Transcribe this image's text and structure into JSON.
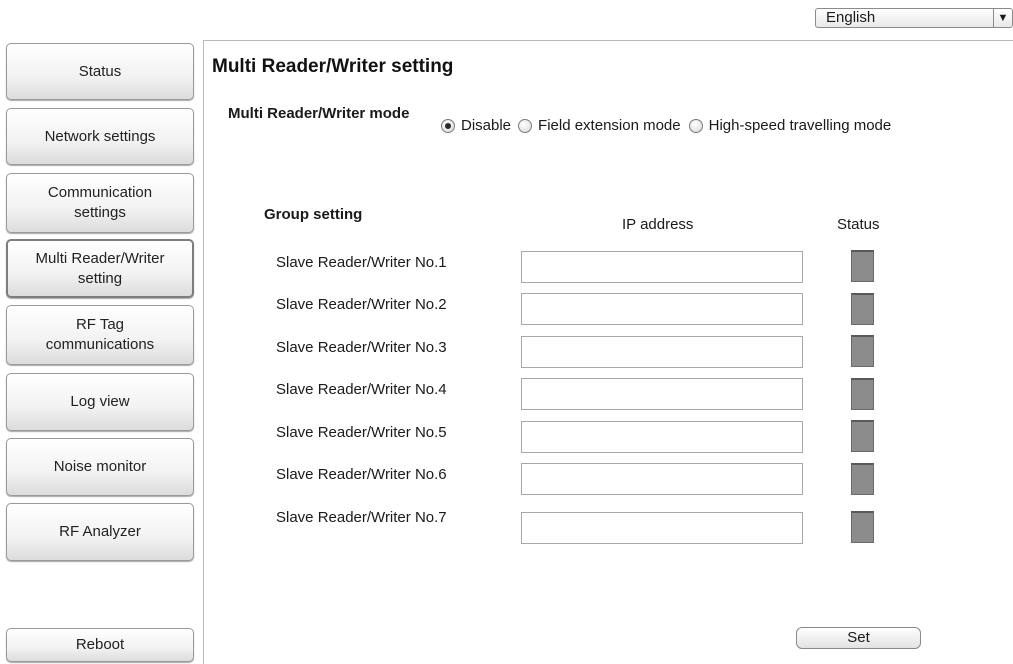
{
  "language": {
    "selected": "English"
  },
  "sidebar": {
    "items": [
      {
        "label": "Status"
      },
      {
        "label": "Network settings"
      },
      {
        "label": "Communication settings"
      },
      {
        "label": "Multi Reader/Writer setting"
      },
      {
        "label": "RF Tag communications"
      },
      {
        "label": "Log view"
      },
      {
        "label": "Noise monitor"
      },
      {
        "label": "RF Analyzer"
      }
    ],
    "reboot_label": "Reboot"
  },
  "main": {
    "title": "Multi Reader/Writer setting",
    "mode": {
      "label": "Multi Reader/Writer mode",
      "options": [
        {
          "label": "Disable",
          "checked": true
        },
        {
          "label": "Field extension mode",
          "checked": false
        },
        {
          "label": "High-speed travelling mode",
          "checked": false
        }
      ]
    },
    "group": {
      "label": "Group setting",
      "col_ip": "IP address",
      "col_status": "Status",
      "rows": [
        {
          "label": "Slave Reader/Writer No.1",
          "ip": ""
        },
        {
          "label": "Slave Reader/Writer No.2",
          "ip": ""
        },
        {
          "label": "Slave Reader/Writer No.3",
          "ip": ""
        },
        {
          "label": "Slave Reader/Writer No.4",
          "ip": ""
        },
        {
          "label": "Slave Reader/Writer No.5",
          "ip": ""
        },
        {
          "label": "Slave Reader/Writer No.6",
          "ip": ""
        },
        {
          "label": "Slave Reader/Writer No.7",
          "ip": ""
        }
      ]
    },
    "set_label": "Set"
  },
  "icons": {
    "dropdown": "chevron-down-icon"
  },
  "colors": {
    "status_indicator": "#8c8c8c"
  }
}
